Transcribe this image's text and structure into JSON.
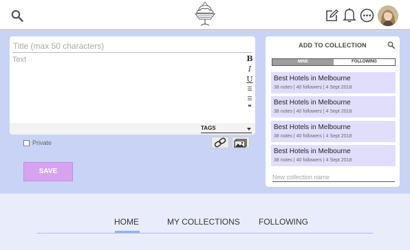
{
  "header": {
    "search_icon": "search-icon",
    "logo_icon": "ice-cream-sundae-icon",
    "actions": [
      "edit-icon",
      "bell-icon",
      "more-icon"
    ],
    "avatar": "user-avatar"
  },
  "editor": {
    "title_placeholder": "Title (max 50 characters)",
    "text_placeholder": "Text",
    "format_tools": [
      {
        "name": "bold",
        "label": "B"
      },
      {
        "name": "italic",
        "label": "I"
      },
      {
        "name": "underline",
        "label": "U"
      },
      {
        "name": "bullet-list",
        "label": "☰"
      },
      {
        "name": "numbered-list",
        "label": "☰"
      },
      {
        "name": "quote",
        "label": "❝"
      }
    ],
    "tags_label": "TAGS"
  },
  "post_options": {
    "private_label": "Private",
    "private_checked": false,
    "save_label": "SAVE"
  },
  "collection_panel": {
    "title": "ADD TO COLLECTION",
    "tabs": [
      {
        "label": "MINE",
        "active": true
      },
      {
        "label": "FOLLOWING",
        "active": false
      }
    ],
    "items": [
      {
        "name": "Best Hotels in Melbourne",
        "meta": "38 notes  |  40 followers  |  4 Sept 2018"
      },
      {
        "name": "Best Hotels in Melbourne",
        "meta": "38 notes  |  40 followers  |  4 Sept 2018"
      },
      {
        "name": "Best Hotels in Melbourne",
        "meta": "38 notes  |  40 followers  |  4 Sept 2018"
      },
      {
        "name": "Best Hotels in Melbourne",
        "meta": "38 notes  |  40 followers  |  4 Sept 2018"
      }
    ],
    "new_collection_placeholder": "New collection name"
  },
  "bottom_nav": {
    "items": [
      {
        "label": "HOME",
        "active": true
      },
      {
        "label": "MY COLLECTIONS",
        "active": false
      },
      {
        "label": "FOLLOWING",
        "active": false
      }
    ]
  },
  "colors": {
    "band": "#c9d3f6",
    "page_bg": "#e9edfb",
    "save_button": "#d7a3f0",
    "collection_item": "#e1defc",
    "nav_accent": "#9bb0ee"
  }
}
